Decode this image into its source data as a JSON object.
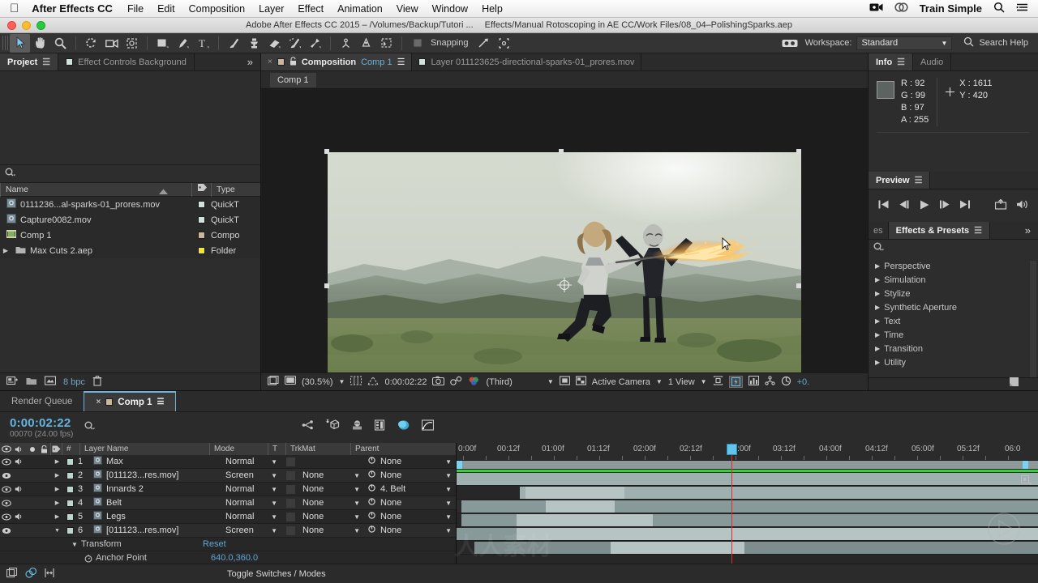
{
  "os_menu": {
    "apple_icon": "apple-icon",
    "app_name": "After Effects CC",
    "items": [
      "File",
      "Edit",
      "Composition",
      "Layer",
      "Effect",
      "Animation",
      "View",
      "Window",
      "Help"
    ],
    "right": {
      "screen_record_icon": "screen-record-icon",
      "cloud_icon": "cloud-sync-icon",
      "user": "Train Simple",
      "search_icon": "spotlight-search-icon",
      "menu_icon": "notification-center-icon"
    }
  },
  "title_bar": {
    "title": "Adobe After Effects CC 2015 – /Volumes/Backup/Tutori ...",
    "path": "Effects/Manual Rotoscoping in AE CC/Work Files/08_04–PolishingSparks.aep"
  },
  "toolbar": {
    "tools": [
      {
        "name": "selection-tool-icon",
        "selected": true
      },
      {
        "name": "hand-tool-icon",
        "selected": false
      },
      {
        "name": "zoom-tool-icon",
        "selected": false
      },
      {
        "name": "rotation-tool-icon",
        "selected": false
      },
      {
        "name": "camera-tool-icon",
        "selected": false
      },
      {
        "name": "pan-behind-tool-icon",
        "selected": false
      },
      {
        "name": "shape-tool-icon",
        "selected": false
      },
      {
        "name": "pen-tool-icon",
        "selected": false
      },
      {
        "name": "type-tool-icon",
        "selected": false
      },
      {
        "name": "brush-tool-icon",
        "selected": false
      },
      {
        "name": "clone-stamp-tool-icon",
        "selected": false
      },
      {
        "name": "eraser-tool-icon",
        "selected": false
      },
      {
        "name": "roto-brush-tool-icon",
        "selected": false
      },
      {
        "name": "puppet-pin-tool-icon",
        "selected": false
      }
    ],
    "snapping_label": "Snapping",
    "workspace_label": "Workspace:",
    "workspace_value": "Standard",
    "search_help": "Search Help"
  },
  "project_panel": {
    "tabs": [
      {
        "label": "Project",
        "active": true,
        "has_menu": true
      },
      {
        "label": "Effect Controls Background",
        "active": false,
        "swatch": "#cfe2dd"
      }
    ],
    "overflow_icon": "chevron-double-right-icon",
    "search_placeholder": "",
    "columns": [
      "Name",
      "Type"
    ],
    "tag_column_icon": "tag-icon",
    "sort_icon": "sort-ascending-icon",
    "items": [
      {
        "name": "0111236...al-sparks-01_prores.mov",
        "icon": "movie-file-icon",
        "tag": "#cfe2dd",
        "type": "QuickT"
      },
      {
        "name": "Capture0082.mov",
        "icon": "movie-file-icon",
        "tag": "#cfe2dd",
        "type": "QuickT"
      },
      {
        "name": "Comp 1",
        "icon": "composition-icon",
        "tag": "#cbb79b",
        "type": "Compo"
      },
      {
        "name": "Max Cuts 2.aep",
        "icon": "folder-icon",
        "tag": "#f2e23c",
        "type": "Folder",
        "expandable": true
      }
    ],
    "footer": {
      "new_comp_icon": "new-composition-icon",
      "new_folder_icon": "new-folder-icon",
      "interpret_icon": "interpret-footage-icon",
      "bit_depth": "8 bpc",
      "delete_icon": "trash-icon"
    }
  },
  "composition_panel": {
    "tabs": [
      {
        "close_icon": "close-icon",
        "swatch": "#cbb79b",
        "lock_icon": "lock-icon",
        "prefix": "Composition",
        "name": "Comp 1",
        "active": true,
        "has_menu": true
      },
      {
        "swatch": "#cfe2dd",
        "label": "Layer 011123625-directional-sparks-01_prores.mov",
        "active": false
      }
    ],
    "sub_tab": "Comp 1",
    "bottom_bar": {
      "toggle_view_masks_icon": "toggle-view-masks-icon",
      "always_preview_icon": "always-preview-icon",
      "magnification": "(30.5%)",
      "choose_grid_icon": "choose-grid-icon",
      "mask_path_icon": "mask-path-icon",
      "current_time": "0:00:02:22",
      "snapshot_icon": "take-snapshot-icon",
      "show_snapshot_icon": "show-snapshot-icon",
      "channel_icon": "show-channel-icon",
      "resolution": "(Third)",
      "region_of_interest_icon": "region-of-interest-icon",
      "transparency_grid_icon": "transparency-grid-icon",
      "camera": "Active Camera",
      "views": "1 View",
      "pixel_aspect_icon": "pixel-aspect-correction-icon",
      "fast_previews_icon": "fast-previews-icon",
      "timeline_icon": "comp-flowchart-icon",
      "flowchart_icon": "composition-flowchart-icon",
      "reset_exposure_icon": "reset-exposure-icon",
      "exposure_value": "+0."
    }
  },
  "info_panel": {
    "tabs": [
      {
        "label": "Info",
        "active": true,
        "has_menu": true
      },
      {
        "label": "Audio",
        "active": false
      }
    ],
    "swatch_color": "#5c6361",
    "r_label": "R :",
    "r": "92",
    "g_label": "G :",
    "g": "99",
    "b_label": "B :",
    "b": "97",
    "a_label": "A :",
    "a": "255",
    "x_label": "X :",
    "x": "1611",
    "y_label": "Y :",
    "y": "420",
    "crosshair_icon": "crosshair-icon"
  },
  "preview_panel": {
    "title": "Preview",
    "has_menu": true,
    "buttons": [
      {
        "name": "first-frame-button",
        "glyph": "first-frame-icon"
      },
      {
        "name": "previous-frame-button",
        "glyph": "previous-frame-icon"
      },
      {
        "name": "play-button",
        "glyph": "play-icon"
      },
      {
        "name": "next-frame-button",
        "glyph": "next-frame-icon"
      },
      {
        "name": "last-frame-button",
        "glyph": "last-frame-icon"
      },
      {
        "name": "loop-button",
        "glyph": "loop-icon"
      },
      {
        "name": "mute-button",
        "glyph": "speaker-icon"
      }
    ]
  },
  "effects_panel": {
    "tabs": [
      {
        "label": "es",
        "active": false
      },
      {
        "label": "Effects & Presets",
        "active": true,
        "has_menu": true
      }
    ],
    "overflow_icon": "chevron-double-right-icon",
    "search_placeholder": "",
    "categories": [
      "Perspective",
      "Simulation",
      "Stylize",
      "Synthetic Aperture",
      "Text",
      "Time",
      "Transition",
      "Utility"
    ]
  },
  "timeline": {
    "tabs": [
      {
        "label": "Render Queue",
        "active": false
      },
      {
        "label": "Comp 1",
        "active": true,
        "swatch": "#cbb79b",
        "close_icon": "close-icon",
        "has_menu": true
      }
    ],
    "current_time": "0:00:02:22",
    "frame_info": "00070 (24.00 fps)",
    "search_placeholder": "",
    "header_icons": [
      "composition-mini-flowchart-icon",
      "draft-3d-icon",
      "hide-shy-layers-icon",
      "frame-blending-icon",
      "motion-blur-icon",
      "graph-editor-icon"
    ],
    "columns": [
      "",
      "",
      "",
      "",
      "",
      "#",
      "Layer Name",
      "Mode",
      "T",
      "TrkMat",
      "Parent"
    ],
    "layers": [
      {
        "num": "1",
        "name": "Max",
        "mode": "Normal",
        "trkmat": "",
        "parent": "None",
        "eye": true,
        "audio": true,
        "color": "#bcd6cf",
        "expanded": false
      },
      {
        "num": "2",
        "name": "[011123...res.mov]",
        "mode": "Screen",
        "trkmat": "None",
        "parent": "None",
        "eye": true,
        "audio": false,
        "color": "#bcd6cf",
        "expanded": false
      },
      {
        "num": "3",
        "name": "Innards 2",
        "mode": "Normal",
        "trkmat": "None",
        "parent": "4. Belt",
        "eye": true,
        "audio": true,
        "color": "#bcd6cf",
        "expanded": false
      },
      {
        "num": "4",
        "name": "Belt",
        "mode": "Normal",
        "trkmat": "None",
        "parent": "None",
        "eye": true,
        "audio": false,
        "color": "#bcd6cf",
        "expanded": false
      },
      {
        "num": "5",
        "name": "Legs",
        "mode": "Normal",
        "trkmat": "None",
        "parent": "None",
        "eye": true,
        "audio": true,
        "color": "#bcd6cf",
        "expanded": false
      },
      {
        "num": "6",
        "name": "[011123...res.mov]",
        "mode": "Screen",
        "trkmat": "None",
        "parent": "None",
        "eye": true,
        "audio": false,
        "color": "#bcd6cf",
        "expanded": true
      }
    ],
    "transform_row": {
      "label": "Transform",
      "reset": "Reset"
    },
    "anchor_point_row": {
      "label": "Anchor Point",
      "value": "640.0,360.0",
      "stopwatch_icon": "stopwatch-icon"
    },
    "ruler_ticks": [
      "0:00f",
      "00:12f",
      "01:00f",
      "01:12f",
      "02:00f",
      "02:12f",
      "03:00f",
      "03:12f",
      "04:00f",
      "04:12f",
      "05:00f",
      "05:12f",
      "06:0"
    ],
    "playhead_time": "02:22",
    "footer": {
      "toggle_switches_modes": "Toggle Switches / Modes",
      "icons": [
        "layer-switches-icon",
        "transfer-controls-icon",
        "stretch-icon"
      ]
    }
  },
  "colors": {
    "accent_blue": "#63b4e0",
    "panel_bg": "#2d2d2d",
    "window_bg": "#232323",
    "playhead_red": "#e02b2b",
    "work_area": "#8e9a9a",
    "green_bar": "#36d13a",
    "layer_bar": "#9fb0b0"
  }
}
